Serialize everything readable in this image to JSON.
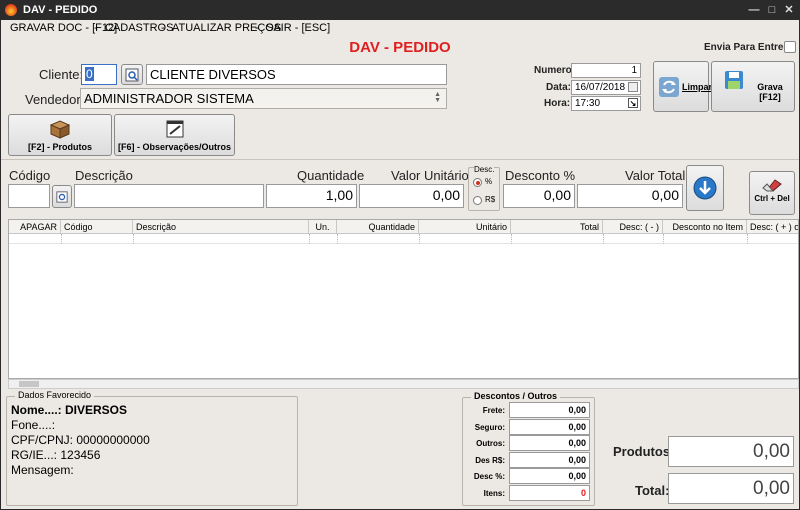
{
  "window": {
    "title": "DAV - PEDIDO",
    "minimize": "—",
    "maximize": "□",
    "close": "✕"
  },
  "menu": [
    {
      "label": "GRAVAR DOC - [F12]"
    },
    {
      "label": "CADASTROS"
    },
    {
      "label": "ATUALIZAR PREÇOS"
    },
    {
      "label": "SAIR - [ESC]"
    }
  ],
  "header": {
    "title": "DAV - PEDIDO",
    "title_color": "#e02020",
    "envia_entrega": "Envia Para Entrega"
  },
  "cliente": {
    "label": "Cliente:",
    "code": "0",
    "name": "CLIENTE DIVERSOS"
  },
  "vendedor": {
    "label": "Vendedor:",
    "value": "ADMINISTRADOR SISTEMA"
  },
  "doc": {
    "numero_label": "Numero:",
    "numero": "1",
    "data_label": "Data:",
    "data": "16/07/2018",
    "hora_label": "Hora:",
    "hora": "17:30"
  },
  "actions": {
    "limpar": "Limpar",
    "grava": "Grava [F12]"
  },
  "tabs": {
    "produtos": "[F2] - Produtos",
    "obs": "[F6] - Observações/Outros"
  },
  "entry": {
    "codigo_label": "Código",
    "descricao_label": "Descrição",
    "quantidade_label": "Quantidade",
    "quantidade": "1,00",
    "valor_unit_label": "Valor Unitário",
    "valor_unit": "0,00",
    "desc_group": "Desc.",
    "opt_percent": "%",
    "opt_rs": "R$",
    "desconto_label": "Desconto %",
    "desconto": "0,00",
    "valor_total_label": "Valor Total",
    "valor_total": "0,00",
    "ctrl_del": "Ctrl + Del"
  },
  "grid": {
    "columns": [
      "APAGAR",
      "Código",
      "Descrição",
      "Un.",
      "Quantidade",
      "Unitário",
      "Total",
      "Desc: ( - )",
      "Desconto no Item",
      "Desc: ( + ) o"
    ]
  },
  "favorecido": {
    "title": "Dados Favorecido",
    "nome": "Nome....: DIVERSOS",
    "fone": "Fone....:",
    "cpf": "CPF/CPNJ: 00000000000",
    "rg": "RG/IE...: 123456",
    "mensagem": "Mensagem:"
  },
  "descontos": {
    "title": "Descontos / Outros",
    "rows": [
      {
        "label": "Frete:",
        "value": "0,00"
      },
      {
        "label": "Seguro:",
        "value": "0,00"
      },
      {
        "label": "Outros:",
        "value": "0,00"
      },
      {
        "label": "Des R$:",
        "value": "0,00"
      },
      {
        "label": "Desc %:",
        "value": "0,00"
      },
      {
        "label": "Itens:",
        "value": "0"
      }
    ],
    "itens_color": "#e02020"
  },
  "totals": {
    "produtos_label": "Produtos:",
    "produtos": "0,00",
    "total_label": "Total:",
    "total": "0,00"
  }
}
